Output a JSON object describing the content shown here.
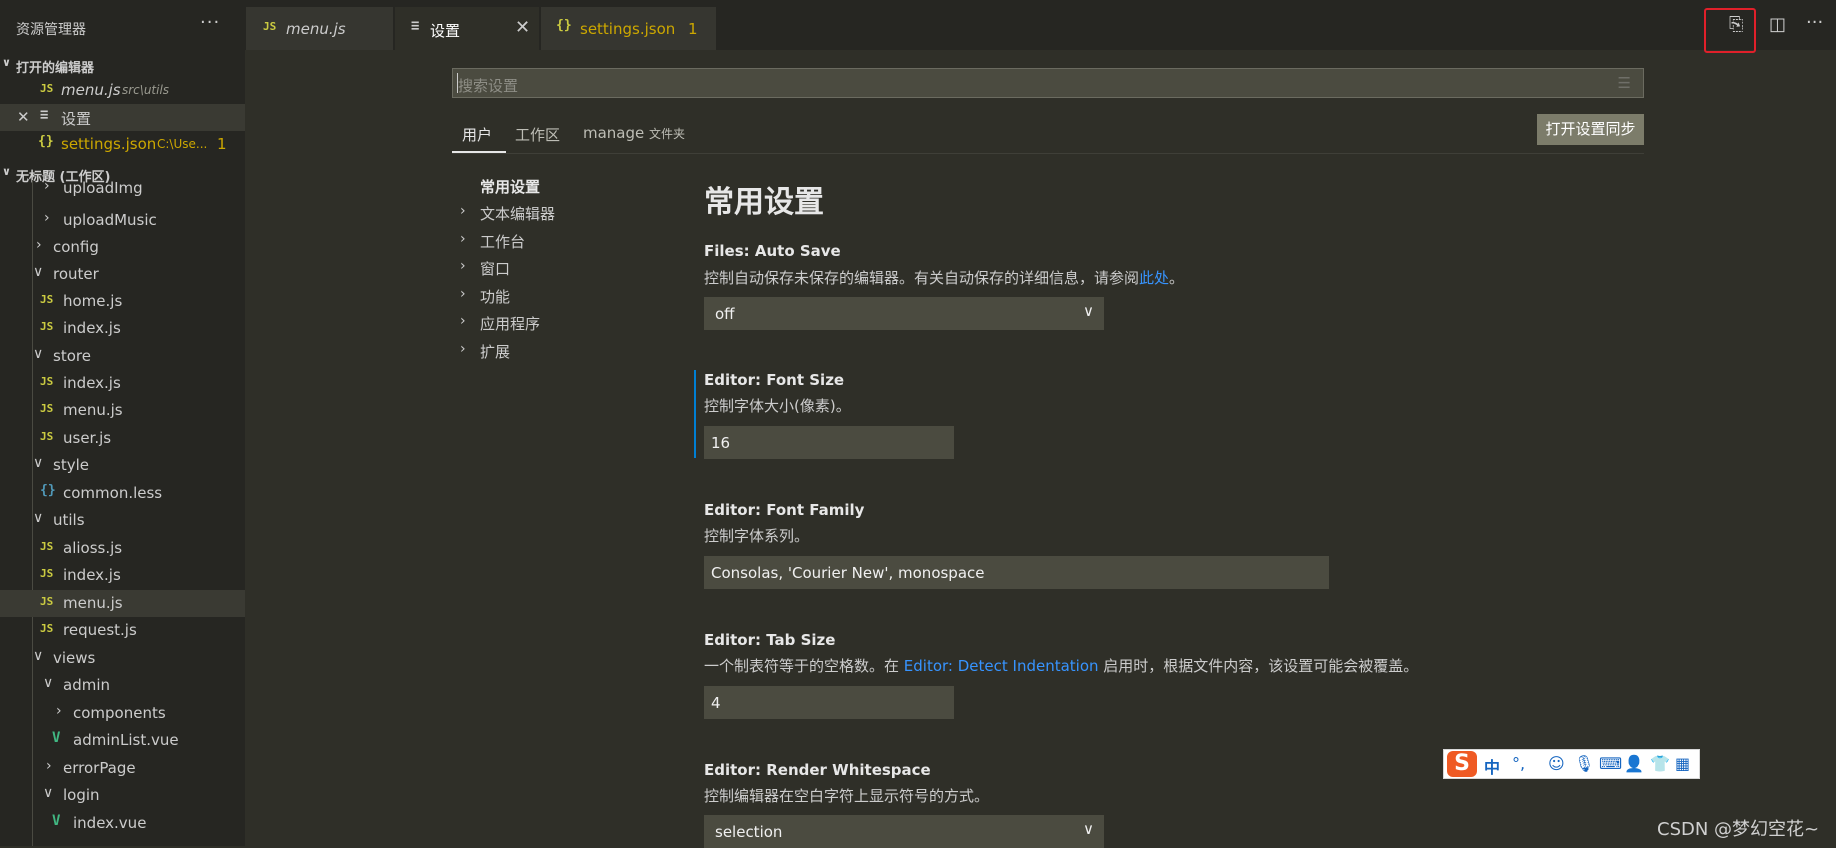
{
  "sidebar": {
    "title": "资源管理器",
    "more": "···",
    "open_editors_header": "打开的编辑器",
    "open_editors": [
      {
        "icon": "JS",
        "name": "menu.js",
        "path": "src\\utils"
      },
      {
        "icon": "≡",
        "close": "✕",
        "name": "设置"
      },
      {
        "icon": "{}",
        "name": "settings.json",
        "path": "C:\\Use...",
        "badge": "1"
      }
    ],
    "workspace_header": "无标题 (工作区)",
    "tree": [
      {
        "label": "uploadImg"
      },
      {
        "label": "uploadMusic"
      },
      {
        "label": "config"
      },
      {
        "label": "router"
      },
      {
        "label": "home.js",
        "icon": "JS"
      },
      {
        "label": "index.js",
        "icon": "JS"
      },
      {
        "label": "store"
      },
      {
        "label": "index.js",
        "icon": "JS"
      },
      {
        "label": "menu.js",
        "icon": "JS"
      },
      {
        "label": "user.js",
        "icon": "JS"
      },
      {
        "label": "style"
      },
      {
        "label": "common.less",
        "icon": "{}"
      },
      {
        "label": "utils"
      },
      {
        "label": "alioss.js",
        "icon": "JS"
      },
      {
        "label": "index.js",
        "icon": "JS"
      },
      {
        "label": "menu.js",
        "icon": "JS"
      },
      {
        "label": "request.js",
        "icon": "JS"
      },
      {
        "label": "views"
      },
      {
        "label": "admin"
      },
      {
        "label": "components"
      },
      {
        "label": "adminList.vue",
        "icon": "V"
      },
      {
        "label": "errorPage"
      },
      {
        "label": "login"
      },
      {
        "label": "index.vue",
        "icon": "V"
      }
    ]
  },
  "tabs": [
    {
      "icon": "JS",
      "label": "menu.js"
    },
    {
      "icon": "≡",
      "label": "设置",
      "close": "✕"
    },
    {
      "icon": "{}",
      "label": "settings.json",
      "badge": "1"
    }
  ],
  "editor_actions": {
    "open_json": "⎘",
    "split": "◫",
    "more": "···"
  },
  "settings": {
    "search_placeholder": "搜索设置",
    "filter_icon": "☰",
    "scope_tabs": [
      "用户",
      "工作区",
      "manage"
    ],
    "scope_folder": "文件夹",
    "sync_button": "打开设置同步",
    "toc": [
      "常用设置",
      "文本编辑器",
      "工作台",
      "窗口",
      "功能",
      "应用程序",
      "扩展"
    ],
    "heading": "常用设置",
    "items": [
      {
        "category": "Files: ",
        "name": "Auto Save",
        "desc": "控制自动保存未保存的编辑器。有关自动保存的详细信息，请参阅",
        "link": "此处",
        "desc_end": "。",
        "value": "off"
      },
      {
        "category": "Editor: ",
        "name": "Font Size",
        "desc": "控制字体大小(像素)。",
        "value": "16"
      },
      {
        "category": "Editor: ",
        "name": "Font Family",
        "desc": "控制字体系列。",
        "value": "Consolas, 'Courier New', monospace"
      },
      {
        "category": "Editor: ",
        "name": "Tab Size",
        "desc": "一个制表符等于的空格数。在 ",
        "link": "Editor: Detect Indentation",
        "desc_end": " 启用时，根据文件内容，该设置可能会被覆盖。",
        "value": "4"
      },
      {
        "category": "Editor: ",
        "name": "Render Whitespace",
        "desc": "控制编辑器在空白字符上显示符号的方式。",
        "value": "selection"
      }
    ]
  },
  "ime_toolbar": {
    "logo": "S",
    "lang": "中",
    "punct": "°,"
  },
  "watermark": "CSDN @梦幻空花~"
}
